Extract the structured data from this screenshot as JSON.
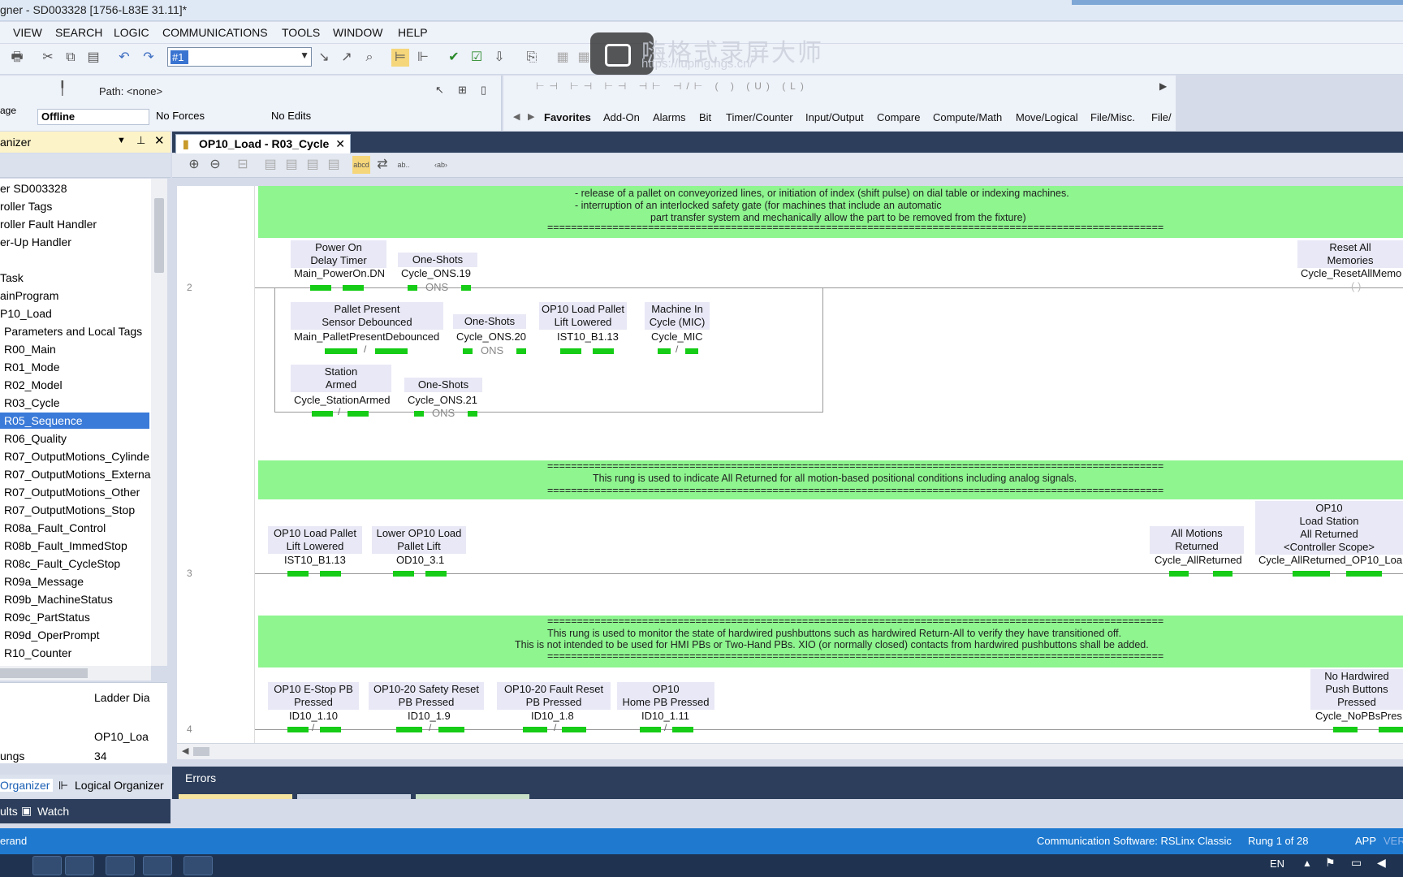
{
  "window": {
    "title": "gner - SD003328 [1756-L83E 31.11]*"
  },
  "menu": [
    "VIEW",
    "SEARCH",
    "LOGIC",
    "COMMUNICATIONS",
    "TOOLS",
    "WINDOW",
    "HELP"
  ],
  "toolbar": {
    "combo_value": "#1"
  },
  "watermark": {
    "text": "嗨格式录屏大师",
    "url": "https://luping.hgs.cn/"
  },
  "pathbar": {
    "path_label": "Path: <none>",
    "mode_label": "age",
    "mode": "Offline",
    "forces": "No Forces",
    "edits": "No Edits"
  },
  "instruction_tabs": [
    "Favorites",
    "Add-On",
    "Alarms",
    "Bit",
    "Timer/Counter",
    "Input/Output",
    "Compare",
    "Compute/Math",
    "Move/Logical",
    "File/Misc.",
    "File/"
  ],
  "organizer": {
    "title": "anizer",
    "tree": [
      "er SD003328",
      "roller Tags",
      "roller Fault Handler",
      "er-Up Handler",
      "",
      "Task",
      "ainProgram",
      "P10_Load",
      "Parameters and Local Tags",
      "R00_Main",
      "R01_Mode",
      "R02_Model",
      "R03_Cycle",
      "R05_Sequence",
      "R06_Quality",
      "R07_OutputMotions_Cylinde",
      "R07_OutputMotions_Externa",
      "R07_OutputMotions_Other",
      "R07_OutputMotions_Stop",
      "R08a_Fault_Control",
      "R08b_Fault_ImmedStop",
      "R08c_Fault_CycleStop",
      "R09a_Message",
      "R09b_MachineStatus",
      "R09c_PartStatus",
      "R09d_OperPrompt",
      "R10_Counter"
    ],
    "selected_index": 13,
    "props": {
      "type_value": "Ladder Dia",
      "name_value": "OP10_Loa",
      "rungs_label": "ungs",
      "rungs_value": "34"
    },
    "tabs": [
      "Organizer",
      "Logical Organizer"
    ],
    "bottom_tabs": [
      "ults",
      "Watch"
    ]
  },
  "editor": {
    "tab_title": "OP10_Load - R03_Cycle",
    "rungs": [
      {
        "number": "2",
        "comment": [
          "- release of a pallet on conveyorized lines, or initiation of index (shift pulse) on dial table or indexing machines.",
          "- interruption of an interlocked safety gate (for machines that include an automatic",
          "part transfer system and mechanically allow the part to be removed from the fixture)",
          "========================================================================================================"
        ],
        "elements": [
          {
            "desc": [
              "Power On",
              "Delay Timer"
            ],
            "tag": "Main_PowerOn.DN"
          },
          {
            "desc": [
              "One-Shots"
            ],
            "tag": "Cycle_ONS.19"
          },
          {
            "desc": [
              "Pallet Present",
              "Sensor Debounced"
            ],
            "tag": "Main_PalletPresentDebounced"
          },
          {
            "desc": [
              "One-Shots"
            ],
            "tag": "Cycle_ONS.20"
          },
          {
            "desc": [
              "OP10 Load Pallet",
              "Lift Lowered"
            ],
            "tag": "IST10_B1.13"
          },
          {
            "desc": [
              "Machine In",
              "Cycle (MIC)"
            ],
            "tag": "Cycle_MIC"
          },
          {
            "desc": [
              "Station",
              "Armed"
            ],
            "tag": "Cycle_StationArmed"
          },
          {
            "desc": [
              "One-Shots"
            ],
            "tag": "Cycle_ONS.21"
          },
          {
            "desc": [
              "Reset All",
              "Memories"
            ],
            "tag": "Cycle_ResetAllMemo"
          }
        ]
      },
      {
        "number": "3",
        "comment": [
          "========================================================================================================",
          "This rung is used to indicate All Returned for all motion-based positional conditions including analog signals.",
          "========================================================================================================"
        ],
        "elements": [
          {
            "desc": [
              "OP10 Load Pallet",
              "Lift Lowered"
            ],
            "tag": "IST10_B1.13"
          },
          {
            "desc": [
              "Lower OP10 Load",
              "Pallet Lift"
            ],
            "tag": "OD10_3.1"
          },
          {
            "desc": [
              "All Motions",
              "Returned"
            ],
            "tag": "Cycle_AllReturned"
          },
          {
            "desc": [
              "OP10",
              "Load Station",
              "All Returned",
              "<Controller Scope>"
            ],
            "tag": "Cycle_AllReturned_OP10_Loa"
          }
        ]
      },
      {
        "number": "4",
        "comment": [
          "========================================================================================================",
          "This rung is used to monitor the state of hardwired pushbuttons such as hardwired Return-All to verify they have transitioned off.",
          "This is not intended to be used for HMI PBs or Two-Hand PBs.  XIO (or normally closed) contacts from hardwired pushbuttons shall be added.",
          "========================================================================================================"
        ],
        "elements": [
          {
            "desc": [
              "OP10 E-Stop PB",
              "Pressed"
            ],
            "tag": "ID10_1.10"
          },
          {
            "desc": [
              "OP10-20 Safety Reset",
              "PB Pressed"
            ],
            "tag": "ID10_1.9"
          },
          {
            "desc": [
              "OP10-20 Fault Reset",
              "PB Pressed"
            ],
            "tag": "ID10_1.8"
          },
          {
            "desc": [
              "OP10",
              "Home PB Pressed"
            ],
            "tag": "ID10_1.11"
          },
          {
            "desc": [
              "No Hardwired",
              "Push Buttons",
              "Pressed"
            ],
            "tag": "Cycle_NoPBsPres"
          }
        ]
      }
    ],
    "ons_label": "ONS"
  },
  "errors_label": "Errors",
  "status": {
    "left": "erand",
    "comm": "Communication Software: RSLinx Classic",
    "rung": "Rung 1 of 28",
    "app": "APP",
    "ver": "VER"
  },
  "taskbar": {
    "lang": "EN"
  }
}
